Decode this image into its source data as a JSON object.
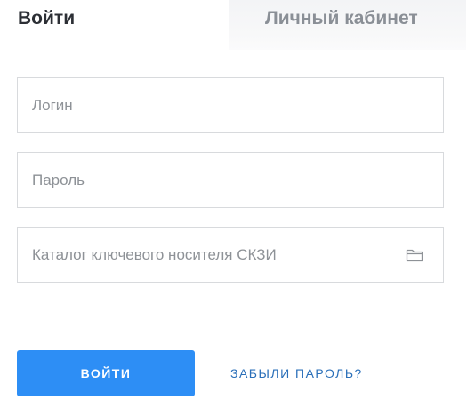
{
  "tabs": {
    "login": "Войти",
    "cabinet": "Личный кабинет"
  },
  "form": {
    "login_placeholder": "Логин",
    "login_value": "",
    "password_placeholder": "Пароль",
    "password_value": "",
    "catalog_placeholder": "Каталог ключевого носителя СКЗИ",
    "catalog_value": "",
    "catalog_icon": "folder-icon"
  },
  "actions": {
    "submit_label": "ВОЙТИ",
    "forgot_label": "ЗАБЫЛИ ПАРОЛЬ?"
  },
  "colors": {
    "accent": "#2d8ef5",
    "link": "#2a6fb9"
  }
}
